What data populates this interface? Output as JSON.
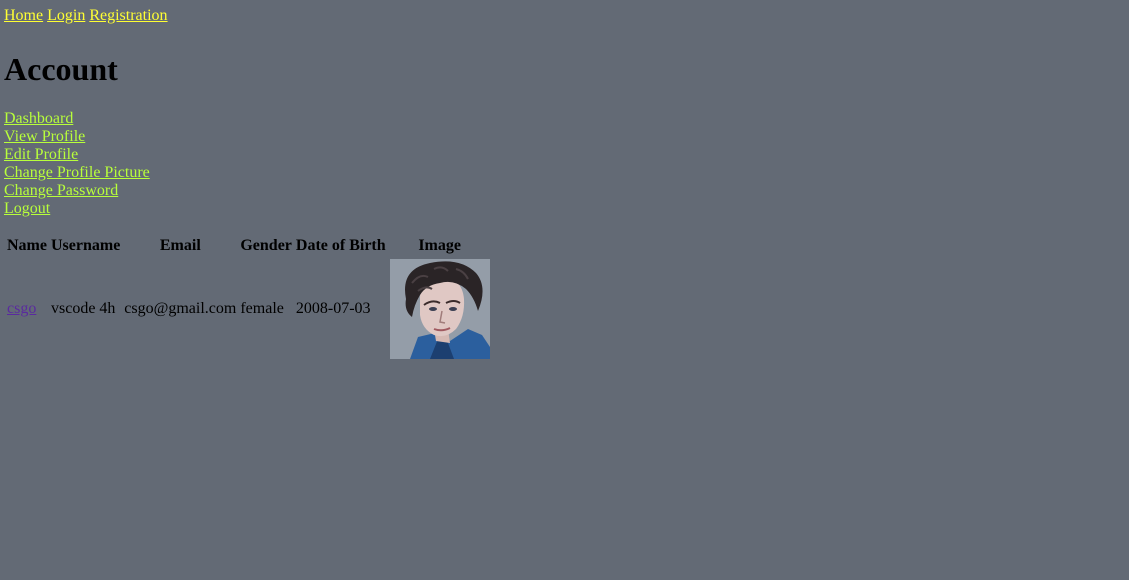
{
  "top_nav": {
    "home": "Home",
    "login": "Login",
    "registration": "Registration"
  },
  "page": {
    "title": "Account"
  },
  "side_nav": {
    "dashboard": "Dashboard",
    "view_profile": "View Profile",
    "edit_profile": "Edit Profile",
    "change_profile_picture": "Change Profile Picture",
    "change_password": "Change Password",
    "logout": "Logout"
  },
  "table": {
    "headers": {
      "name": "Name",
      "username": "Username",
      "email": "Email",
      "gender": "Gender",
      "dob": "Date of Birth",
      "image": "Image"
    },
    "row": {
      "name": "csgo",
      "username": "vscode 4h",
      "email": "csgo@gmail.com",
      "gender": "female",
      "dob": "2008-07-03",
      "image_icon": "portrait-image"
    }
  },
  "colors": {
    "background": "#636a75",
    "top_nav_link": "#ffff33",
    "side_nav_link": "#b8ff3b",
    "visited_link": "#5a2a9f"
  }
}
